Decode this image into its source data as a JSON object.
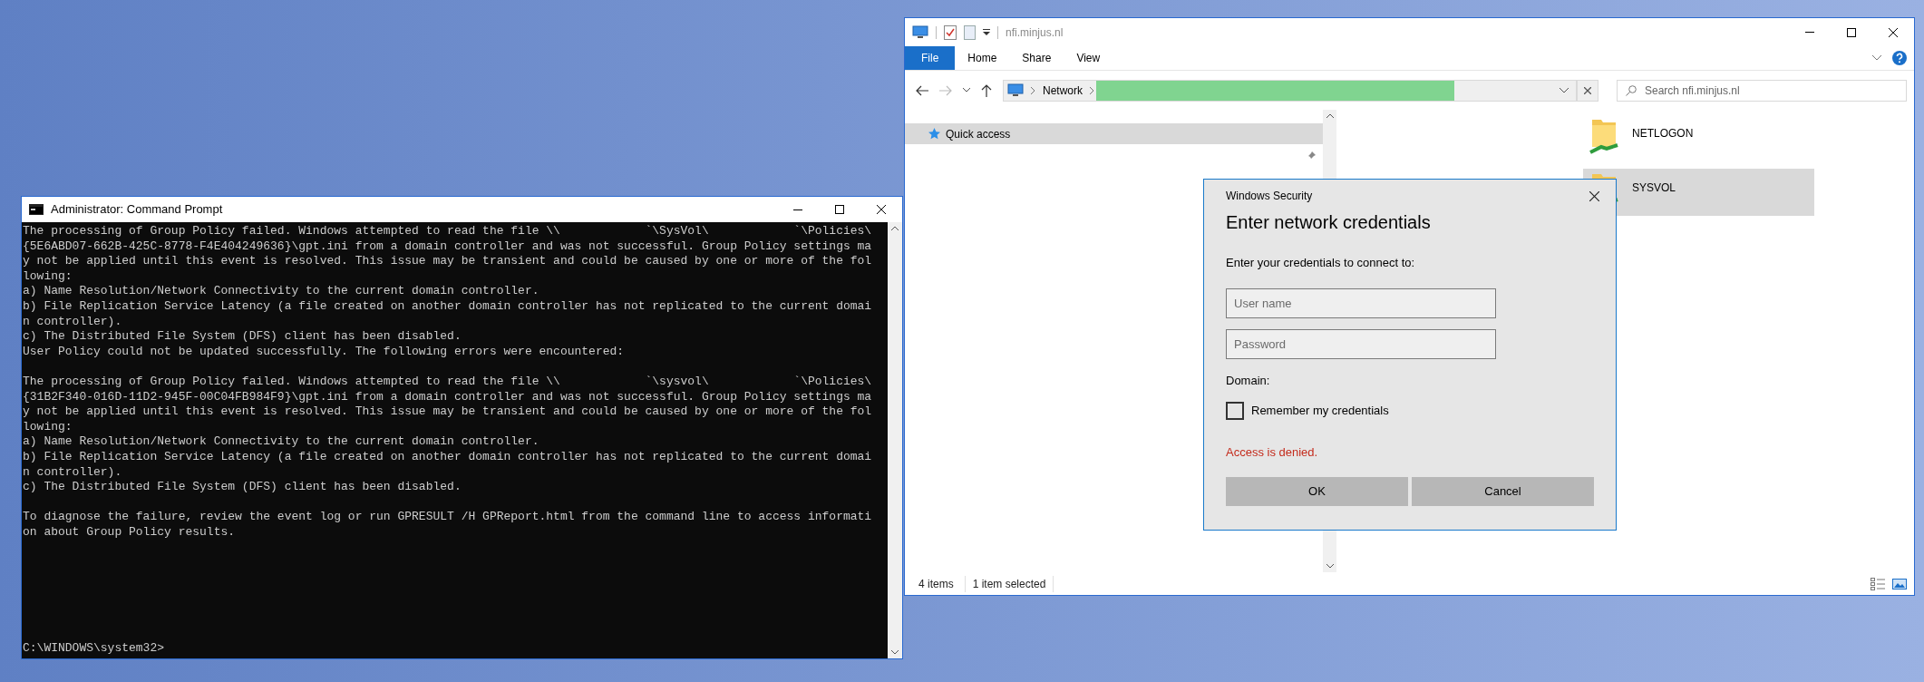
{
  "command_prompt": {
    "title": "Administrator: Command Prompt",
    "blocks": [
      [
        "The processing of Group Policy failed. Windows attempted to read the file \\\\            `\\SysVol\\            `\\Policies\\",
        "{5E6ABD07-662B-425C-8778-F4E404249636}\\gpt.ini from a domain controller and was not successful. Group Policy settings ma",
        "y not be applied until this event is resolved. This issue may be transient and could be caused by one or more of the fol",
        "lowing:",
        "a) Name Resolution/Network Connectivity to the current domain controller.",
        "b) File Replication Service Latency (a file created on another domain controller has not replicated to the current domai",
        "n controller).",
        "c) The Distributed File System (DFS) client has been disabled.",
        "User Policy could not be updated successfully. The following errors were encountered:"
      ],
      [
        "The processing of Group Policy failed. Windows attempted to read the file \\\\            `\\sysvol\\            `\\Policies\\",
        "{31B2F340-016D-11D2-945F-00C04FB984F9}\\gpt.ini from a domain controller and was not successful. Group Policy settings ma",
        "y not be applied until this event is resolved. This issue may be transient and could be caused by one or more of the fol",
        "lowing:",
        "a) Name Resolution/Network Connectivity to the current domain controller.",
        "b) File Replication Service Latency (a file created on another domain controller has not replicated to the current domai",
        "n controller).",
        "c) The Distributed File System (DFS) client has been disabled."
      ],
      [
        "To diagnose the failure, review the event log or run GPRESULT /H GPReport.html from the command line to access informati",
        "on about Group Policy results."
      ]
    ],
    "prompt": "C:\\WINDOWS\\system32>"
  },
  "explorer": {
    "title": "nfi.minjus.nl",
    "ribbon_tabs": [
      {
        "label": "File",
        "selected": true
      },
      {
        "label": "Home",
        "selected": false
      },
      {
        "label": "Share",
        "selected": false
      },
      {
        "label": "View",
        "selected": false
      }
    ],
    "address": {
      "crumbs": [
        "Network"
      ]
    },
    "search": {
      "placeholder": "Search nfi.minjus.nl"
    },
    "nav_items": [
      {
        "label": "Quick access",
        "selected": true
      }
    ],
    "items": [
      {
        "label": "NETLOGON",
        "selected": false
      },
      {
        "label": "SYSVOL",
        "selected": true
      }
    ],
    "status": {
      "count": "4 items",
      "selection": "1 item selected"
    }
  },
  "dialog": {
    "title": "Windows Security",
    "heading": "Enter network credentials",
    "prompt": "Enter your credentials to connect to:",
    "fields": [
      {
        "placeholder": "User name"
      },
      {
        "placeholder": "Password"
      }
    ],
    "domain_label": "Domain:",
    "remember": {
      "label": "Remember my credentials",
      "checked": false
    },
    "error": "Access is denied.",
    "buttons": [
      "OK",
      "Cancel"
    ]
  }
}
